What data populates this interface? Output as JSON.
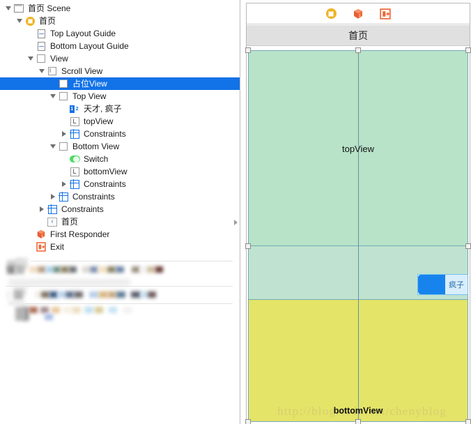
{
  "outline": {
    "name": "document-outline",
    "rows": [
      {
        "label": "首页 Scene",
        "depth": 0,
        "twisty": "down",
        "icon": "scene-icon",
        "selected": false
      },
      {
        "label": "首页",
        "depth": 1,
        "twisty": "down",
        "icon": "view-controller-icon",
        "selected": false
      },
      {
        "label": "Top Layout Guide",
        "depth": 2,
        "twisty": "none",
        "icon": "top-layout-guide-icon",
        "selected": false
      },
      {
        "label": "Bottom Layout Guide",
        "depth": 2,
        "twisty": "none",
        "icon": "bottom-layout-guide-icon",
        "selected": false
      },
      {
        "label": "View",
        "depth": 2,
        "twisty": "down",
        "icon": "view-icon",
        "selected": false
      },
      {
        "label": "Scroll View",
        "depth": 3,
        "twisty": "down",
        "icon": "scroll-view-icon",
        "selected": false
      },
      {
        "label": "占位View",
        "depth": 4,
        "twisty": "none",
        "icon": "view-icon",
        "selected": true
      },
      {
        "label": "Top View",
        "depth": 4,
        "twisty": "down",
        "icon": "view-icon",
        "selected": false
      },
      {
        "label": "天才, 疯子",
        "depth": 5,
        "twisty": "none",
        "icon": "segmented-control-icon",
        "selected": false
      },
      {
        "label": "topView",
        "depth": 5,
        "twisty": "none",
        "icon": "label-icon",
        "selected": false
      },
      {
        "label": "Constraints",
        "depth": 5,
        "twisty": "right",
        "icon": "constraints-icon",
        "selected": false
      },
      {
        "label": "Bottom View",
        "depth": 4,
        "twisty": "down",
        "icon": "view-icon",
        "selected": false
      },
      {
        "label": "Switch",
        "depth": 5,
        "twisty": "none",
        "icon": "switch-icon",
        "selected": false
      },
      {
        "label": "bottomView",
        "depth": 5,
        "twisty": "none",
        "icon": "label-icon",
        "selected": false
      },
      {
        "label": "Constraints",
        "depth": 5,
        "twisty": "right",
        "icon": "constraints-icon",
        "selected": false
      },
      {
        "label": "Constraints",
        "depth": 4,
        "twisty": "right",
        "icon": "constraints-icon",
        "selected": false
      },
      {
        "label": "Constraints",
        "depth": 3,
        "twisty": "right",
        "icon": "constraints-icon",
        "selected": false
      },
      {
        "label": "首页",
        "depth": 3,
        "twisty": "none",
        "icon": "back-bar-button-icon",
        "selected": false
      },
      {
        "label": "First Responder",
        "depth": 2,
        "twisty": "none",
        "icon": "first-responder-icon",
        "selected": false
      },
      {
        "label": "Exit",
        "depth": 2,
        "twisty": "none",
        "icon": "exit-icon",
        "selected": false
      }
    ]
  },
  "canvas": {
    "name": "interface-builder-canvas",
    "toolbar_icons": [
      "view-controller-icon",
      "first-responder-icon",
      "exit-icon"
    ],
    "navbar_title": "首页",
    "top_view_label": "topView",
    "bottom_view_label": "bottomView",
    "switch_label": "疯子",
    "watermark": "http://blog.csdn.net/chenyblog"
  },
  "colors": {
    "selection_blue": "#1272e8",
    "top_view_green": "#b8e3c8",
    "mid_view_green": "#bfe3d0",
    "bottom_view_yellow": "#e4e468",
    "view_border": "#74a9b8",
    "switch_on_blue": "#1784ee",
    "navbar_gray": "#e0e0e0",
    "accent_orange": "#f0693a",
    "vc_yellow": "#f0b323"
  }
}
